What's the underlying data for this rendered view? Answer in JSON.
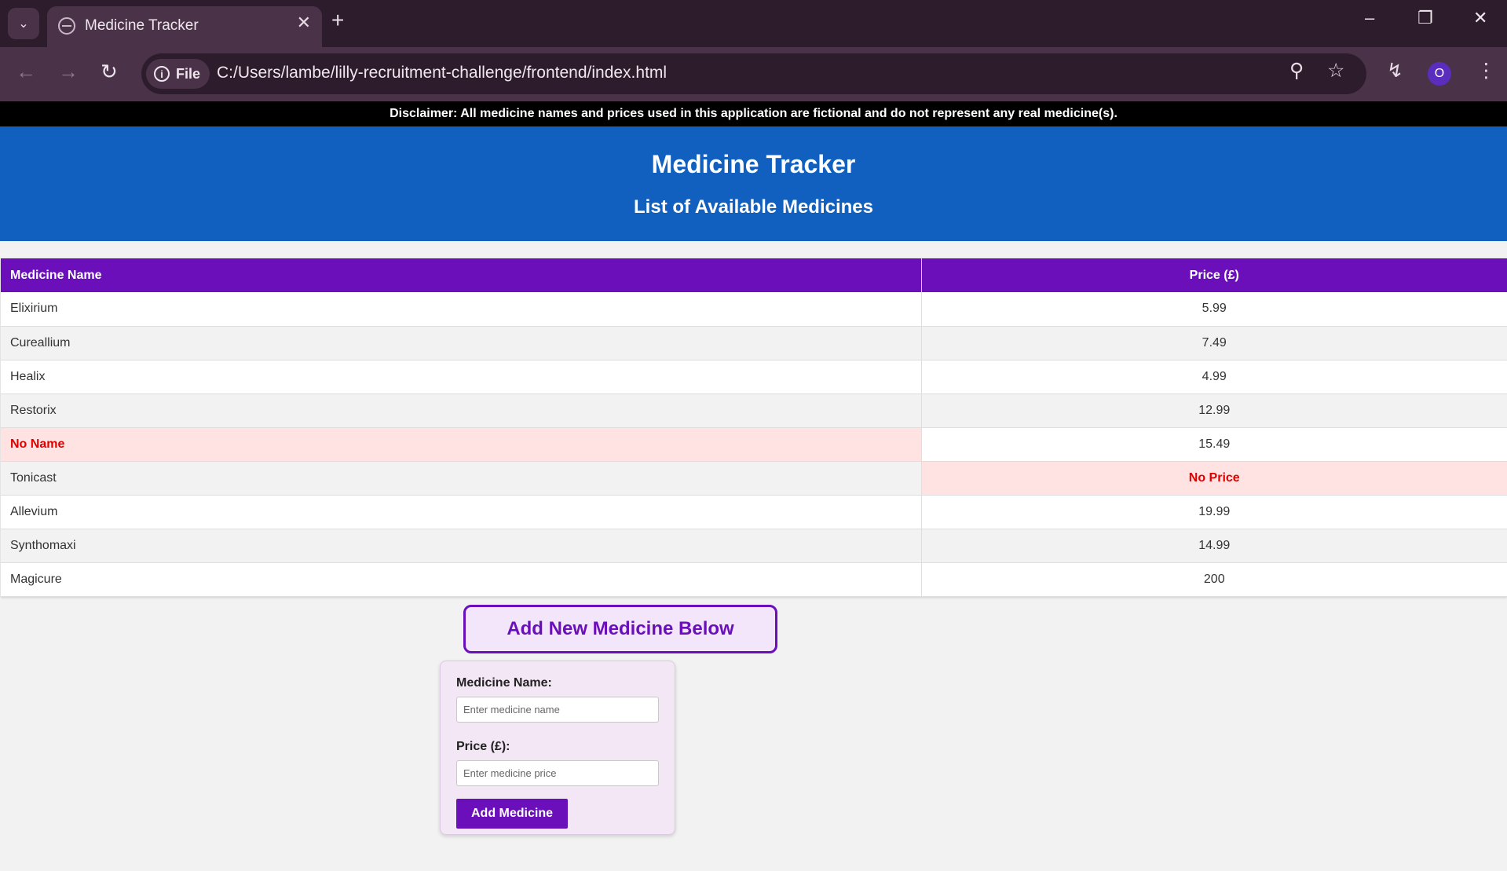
{
  "browser": {
    "tab_title": "Medicine Tracker",
    "file_label": "File",
    "url": "C:/Users/lambe/lilly-recruitment-challenge/frontend/index.html",
    "profile_initial": "O"
  },
  "page": {
    "disclaimer": "Disclaimer: All medicine names and prices used in this application are fictional and do not represent any real medicine(s).",
    "title": "Medicine Tracker",
    "subtitle": "List of Available Medicines",
    "table": {
      "headers": {
        "name": "Medicine Name",
        "price": "Price (£)"
      },
      "rows": [
        {
          "name": "Elixirium",
          "price": "5.99"
        },
        {
          "name": "Cureallium",
          "price": "7.49"
        },
        {
          "name": "Healix",
          "price": "4.99"
        },
        {
          "name": "Restorix",
          "price": "12.99"
        },
        {
          "name": "No Name",
          "price": "15.49"
        },
        {
          "name": "Tonicast",
          "price": "No Price"
        },
        {
          "name": "Allevium",
          "price": "19.99"
        },
        {
          "name": "Synthomaxi",
          "price": "14.99"
        },
        {
          "name": "Magicure",
          "price": "200"
        }
      ]
    },
    "add_heading": "Add New Medicine Below",
    "form": {
      "name_label": "Medicine Name:",
      "name_placeholder": "Enter medicine name",
      "price_label": "Price (£):",
      "price_placeholder": "Enter medicine price",
      "submit_label": "Add Medicine"
    }
  },
  "colors": {
    "header_bg": "#1160bf",
    "table_header_bg": "#6a0fba",
    "error_text": "#e00000",
    "error_bg": "#ffe3e3"
  }
}
